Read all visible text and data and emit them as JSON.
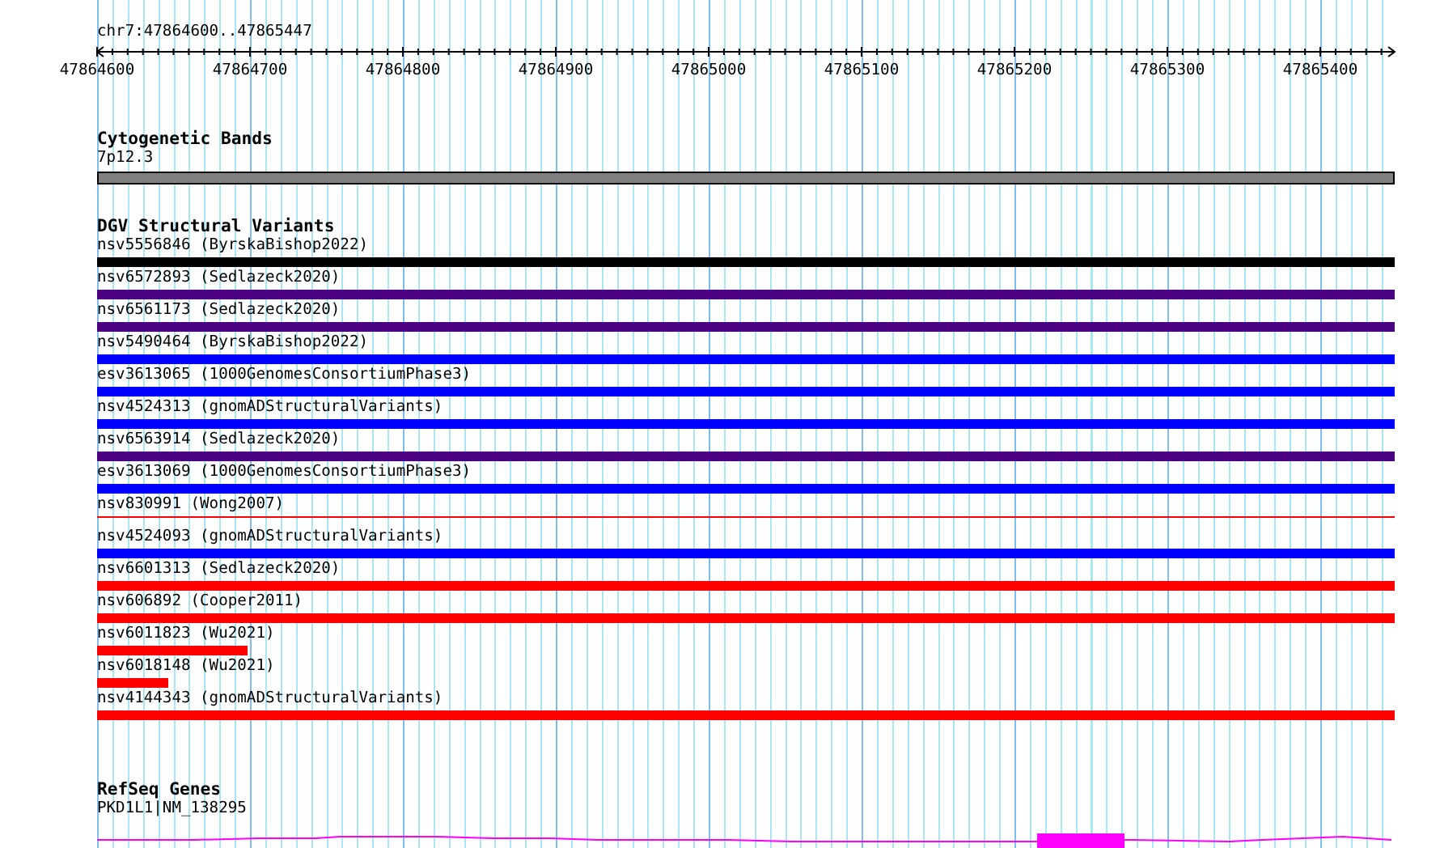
{
  "ruler": {
    "location": "chr7:47864600..47865447",
    "ticks": [
      "47864600",
      "47864700",
      "47864800",
      "47864900",
      "47865000",
      "47865100",
      "47865200",
      "47865300",
      "47865400"
    ]
  },
  "cytobands": {
    "title": "Cytogenetic Bands",
    "band": "7p12.3"
  },
  "dgv": {
    "title": "DGV Structural Variants",
    "variants": [
      {
        "label": "nsv5556846 (ByrskaBishop2022)",
        "kind": "bar",
        "color": "#000000",
        "level": 1
      },
      {
        "label": "nsv6572893 (Sedlazeck2020)",
        "kind": "bar",
        "color": "#4b0082",
        "level": 1
      },
      {
        "label": "nsv6561173 (Sedlazeck2020)",
        "kind": "bar",
        "color": "#4b0082",
        "level": 1
      },
      {
        "label": "nsv5490464 (ByrskaBishop2022)",
        "kind": "bar",
        "color": "#0000ff",
        "level": 1
      },
      {
        "label": "esv3613065 (1000GenomesConsortiumPhase3)",
        "kind": "bar",
        "color": "#0000ff",
        "level": 1
      },
      {
        "label": "nsv4524313 (gnomADStructuralVariants)",
        "kind": "bar",
        "color": "#0000ff",
        "level": 1
      },
      {
        "label": "nsv6563914 (Sedlazeck2020)",
        "kind": "bar",
        "color": "#4b0082",
        "level": 1
      },
      {
        "label": "esv3613069 (1000GenomesConsortiumPhase3)",
        "kind": "bar",
        "color": "#0000ff",
        "level": 1
      },
      {
        "label": "nsv830991 (Wong2007)",
        "kind": "line",
        "color": "#ff0000",
        "level": 1
      },
      {
        "label": "nsv4524093 (gnomADStructuralVariants)",
        "kind": "bar",
        "color": "#0000ff",
        "level": 1
      },
      {
        "label": "nsv6601313 (Sedlazeck2020)",
        "kind": "bar",
        "color": "#ff0000",
        "level": 1
      },
      {
        "label": "nsv606892 (Cooper2011)",
        "kind": "bar",
        "color": "#ff0000",
        "level": 1
      },
      {
        "label": "nsv6011823 (Wu2021)",
        "kind": "bar",
        "color": "#ff0000",
        "level": 0.116
      },
      {
        "label": "nsv6018148 (Wu2021)",
        "kind": "bar",
        "color": "#ff0000",
        "level": 0.055
      },
      {
        "label": "nsv4144343 (gnomADStructuralVariants)",
        "kind": "bar",
        "color": "#ff0000",
        "level": 1
      }
    ]
  },
  "refseq": {
    "title": "RefSeq Genes",
    "gene": "PKD1L1|NM_138295"
  }
}
